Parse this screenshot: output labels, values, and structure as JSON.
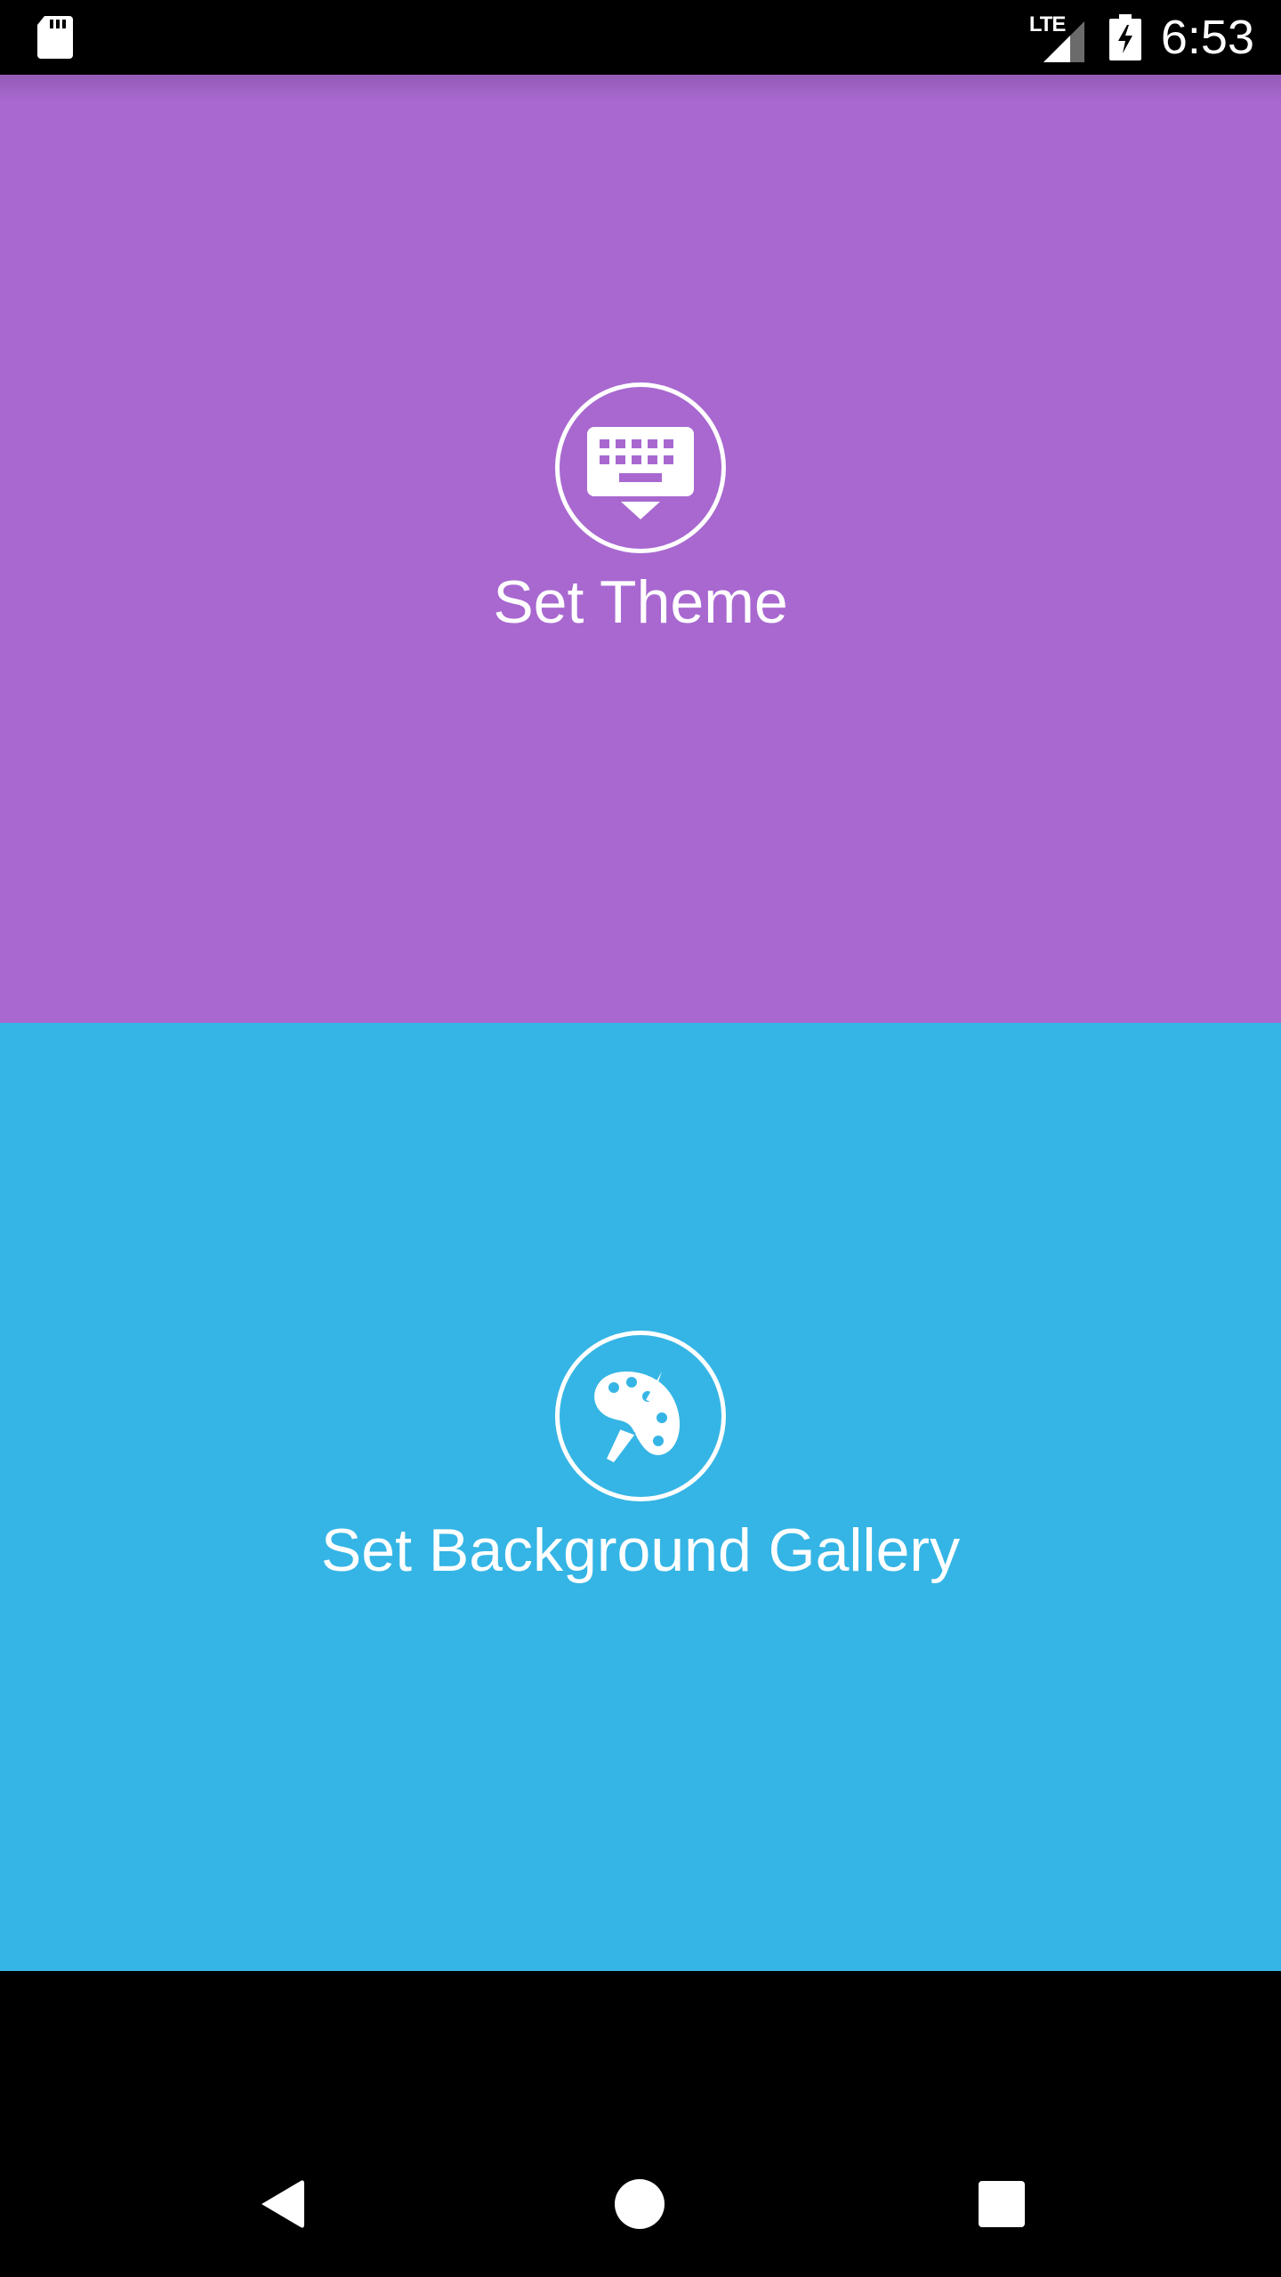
{
  "status_bar": {
    "network_label": "LTE",
    "time": "6:53",
    "icons": [
      "sd-card-icon",
      "lte-signal-icon",
      "battery-charging-icon"
    ]
  },
  "panels": {
    "theme": {
      "label": "Set Theme",
      "icon": "keyboard-icon",
      "background_color": "#A868D0"
    },
    "gallery": {
      "label": "Set Background Gallery",
      "icon": "palette-icon",
      "background_color": "#35B5E5"
    }
  },
  "nav_bar": {
    "buttons": [
      "back-icon",
      "home-icon",
      "recents-icon"
    ]
  }
}
